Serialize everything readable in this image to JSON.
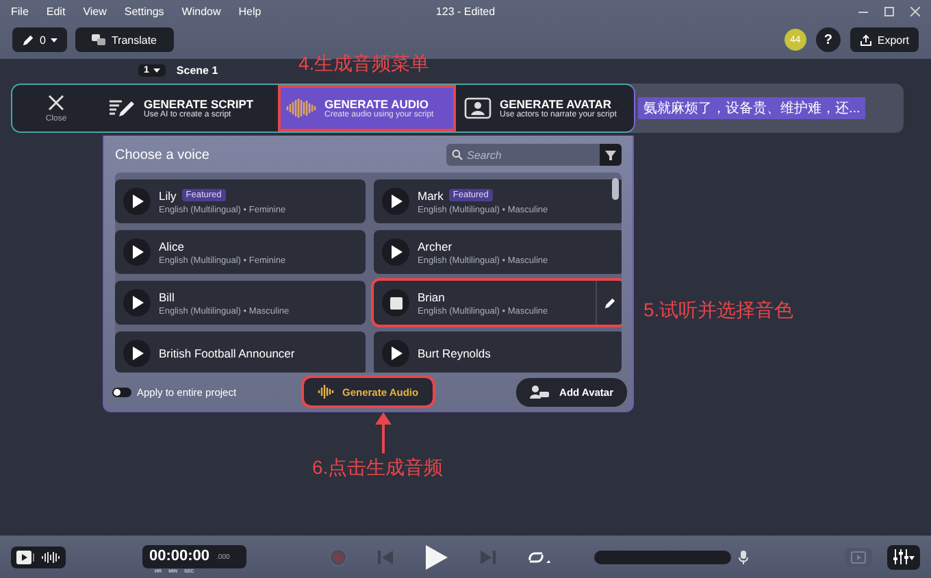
{
  "menu": [
    "File",
    "Edit",
    "View",
    "Settings",
    "Window",
    "Help"
  ],
  "window": {
    "title": "123 - Edited"
  },
  "toolbar": {
    "edit_count": "0",
    "translate": "Translate",
    "badge": "44",
    "help": "?",
    "export": "Export"
  },
  "scene": {
    "number": "1",
    "name": "Scene 1"
  },
  "close_label": "Close",
  "tabs": [
    {
      "kind": "script",
      "title": "GENERATE SCRIPT",
      "subtitle": "Use AI to create a script",
      "selected": false,
      "highlighted": false
    },
    {
      "kind": "audio",
      "title": "GENERATE AUDIO",
      "subtitle": "Create audio using your script",
      "selected": true,
      "highlighted": true
    },
    {
      "kind": "avatar",
      "title": "GENERATE AVATAR",
      "subtitle": "Use actors to narrate your script",
      "selected": false,
      "highlighted": false
    }
  ],
  "script_text": "氨就麻烦了，设备贵、维护难，还...",
  "voice_panel": {
    "title": "Choose a voice",
    "search": {
      "placeholder": "Search"
    }
  },
  "voices": [
    {
      "name": "Lily",
      "badge": "Featured",
      "subtitle": "English (Multilingual) • Feminine",
      "selected": false,
      "highlighted": false
    },
    {
      "name": "Mark",
      "badge": "Featured",
      "subtitle": "English (Multilingual) • Masculine",
      "selected": false,
      "highlighted": false
    },
    {
      "name": "Alice",
      "subtitle": "English (Multilingual) • Feminine",
      "selected": false,
      "highlighted": false
    },
    {
      "name": "Archer",
      "subtitle": "English (Multilingual) • Masculine",
      "selected": false,
      "highlighted": false
    },
    {
      "name": "Bill",
      "subtitle": "English (Multilingual) • Masculine",
      "selected": false,
      "highlighted": false
    },
    {
      "name": "Brian",
      "subtitle": "English (Multilingual) • Masculine",
      "selected": true,
      "highlighted": true
    },
    {
      "name": "British Football Announcer",
      "selected": false,
      "highlighted": false
    },
    {
      "name": "Burt Reynolds",
      "selected": false,
      "highlighted": false
    }
  ],
  "footer": {
    "toggle": {
      "label": "Apply to entire project",
      "on": false
    },
    "generate": {
      "label": "Generate Audio",
      "highlighted": true
    },
    "add_avatar": "Add Avatar"
  },
  "player": {
    "timecode": "00:00:00",
    "units": [
      "HR",
      "MIN",
      "SEC"
    ],
    "millis": ".000"
  },
  "annotations": [
    {
      "kind": "menu",
      "text": "4.生成音频菜单"
    },
    {
      "kind": "voice",
      "text": "5.试听并选择音色"
    },
    {
      "kind": "button",
      "text": "6.点击生成音频"
    }
  ]
}
